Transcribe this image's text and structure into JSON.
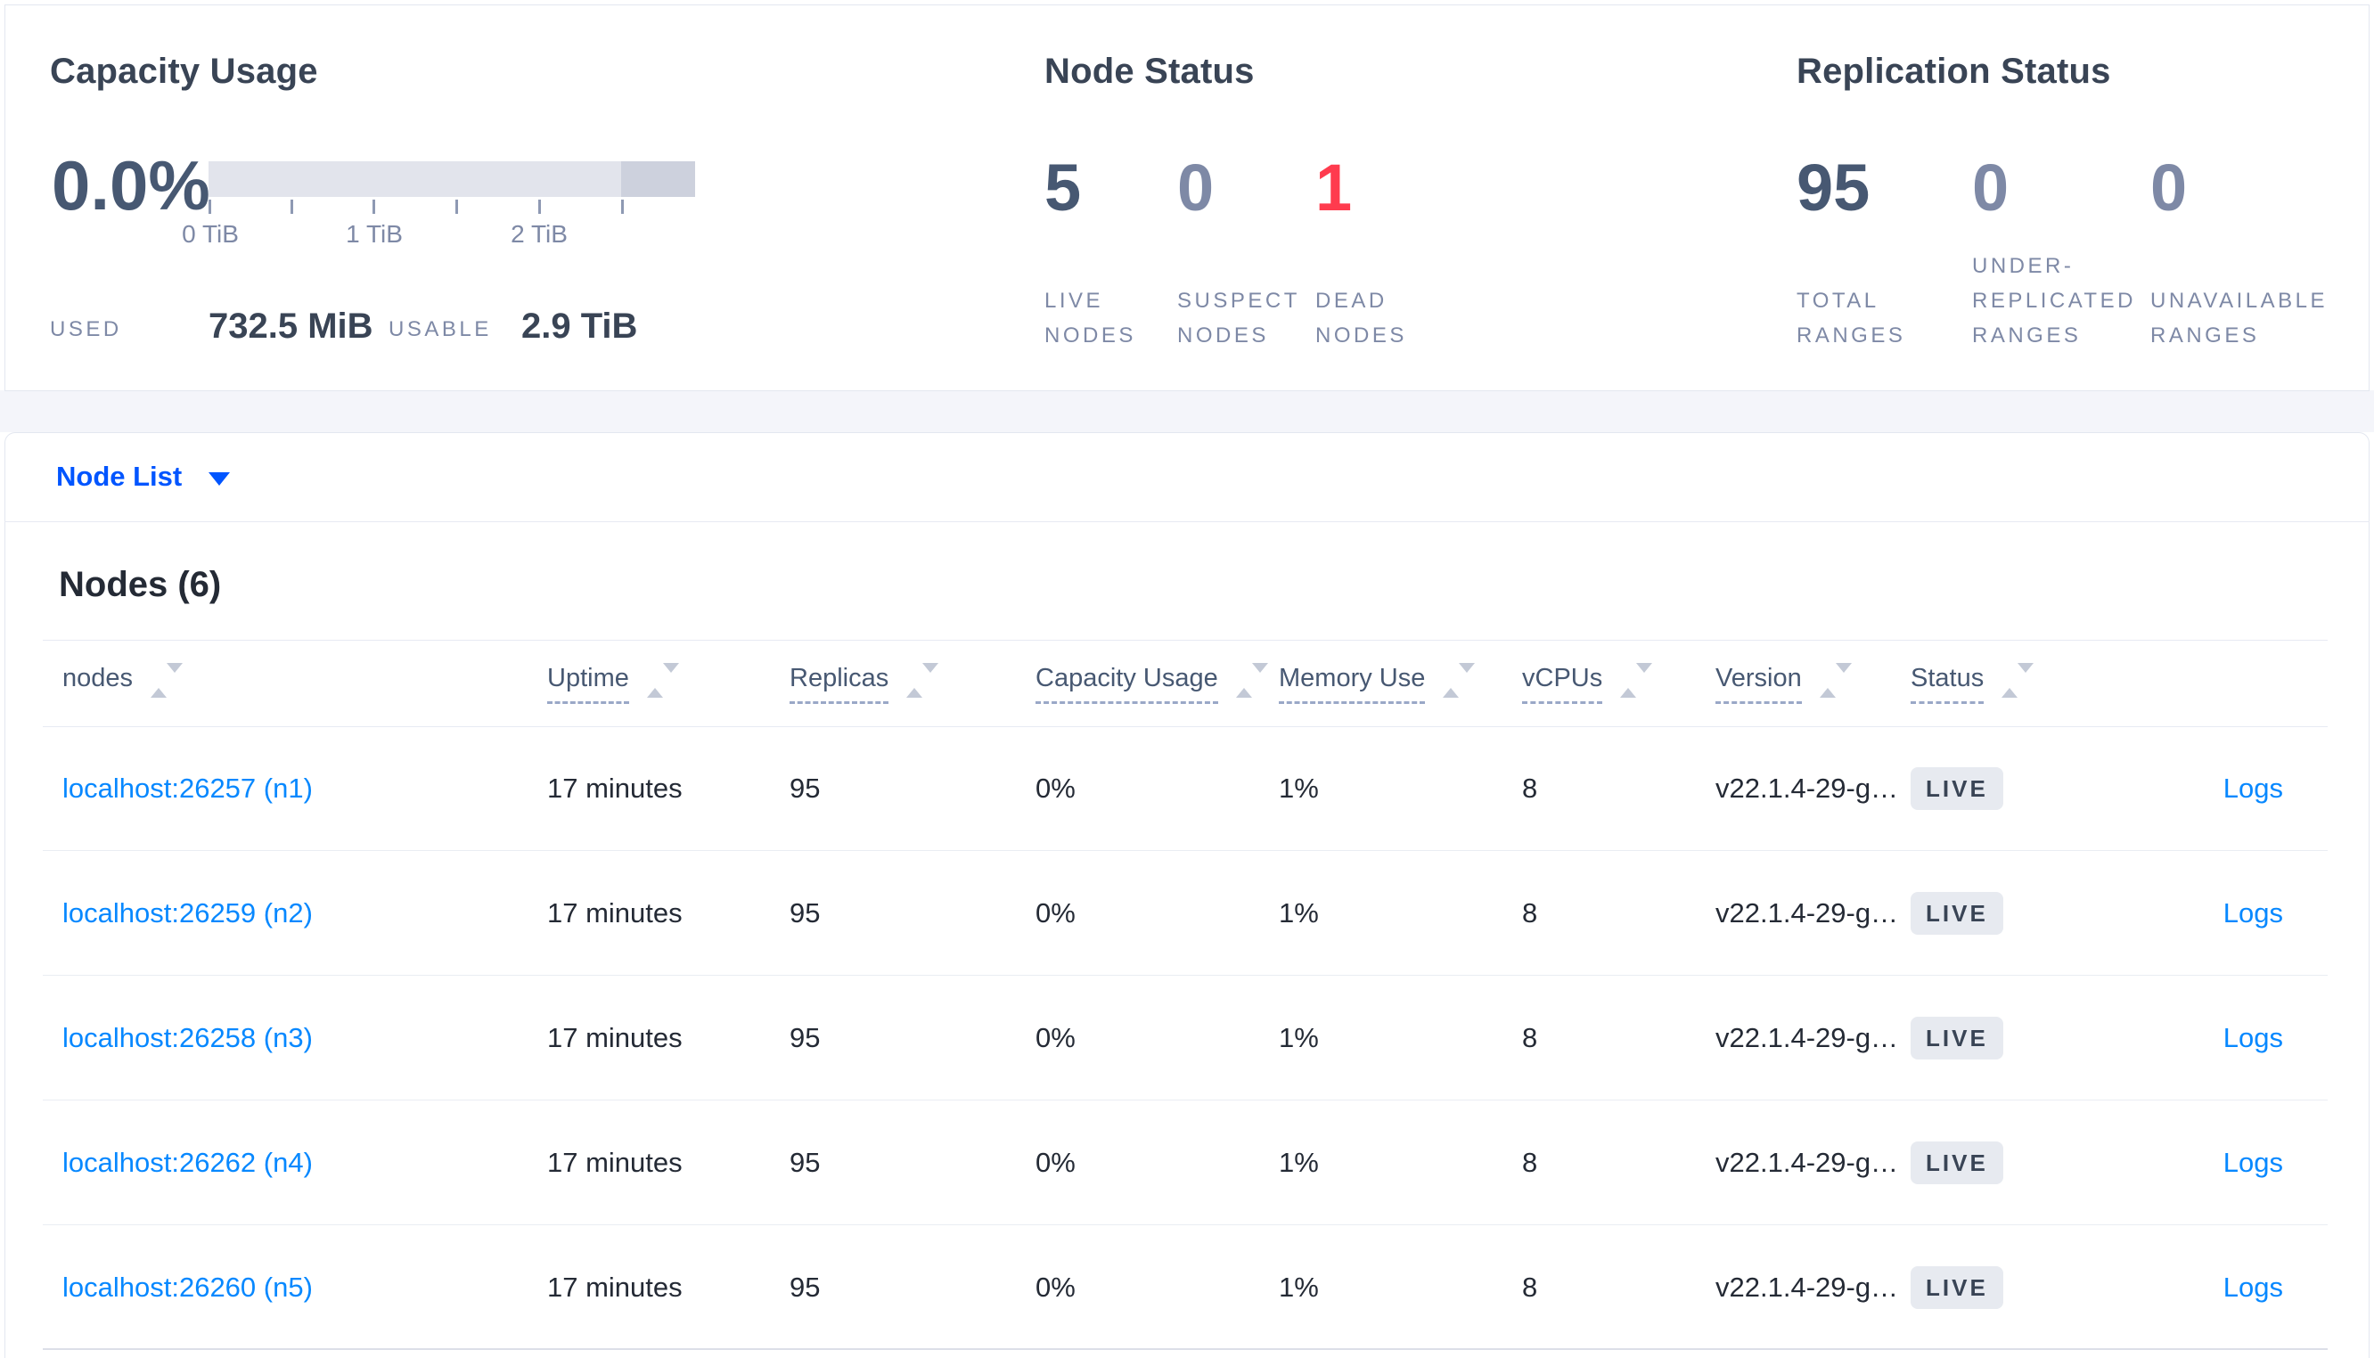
{
  "colors": {
    "link_blue": "#0788ff",
    "selector_blue": "#0055ff",
    "title_dark": "#394455",
    "stat_dark": "#475872",
    "stat_muted": "#7e89a6",
    "dead_red": "#ff3b4e",
    "badge_bg": "#e7eaf0",
    "page_band_bg": "#f4f5fa"
  },
  "summary": {
    "capacity": {
      "title": "Capacity Usage",
      "percent": "0.0%",
      "ticks": [
        "0 TiB",
        "1 TiB",
        "2 TiB"
      ],
      "used_label": "USED",
      "used_value": "732.5 MiB",
      "usable_label": "USABLE",
      "usable_value": "2.9 TiB"
    },
    "node_status": {
      "title": "Node Status",
      "stats": [
        {
          "value": "5",
          "label": "LIVE\nNODES",
          "color": "#475872"
        },
        {
          "value": "0",
          "label": "SUSPECT\nNODES",
          "color": "#7e89a6"
        },
        {
          "value": "1",
          "label": "DEAD\nNODES",
          "color": "#ff3b4e"
        }
      ]
    },
    "replication_status": {
      "title": "Replication Status",
      "stats": [
        {
          "value": "95",
          "label": "TOTAL\nRANGES",
          "color": "#475872"
        },
        {
          "value": "0",
          "label": "UNDER-\nREPLICATED\nRANGES",
          "color": "#7e89a6"
        },
        {
          "value": "0",
          "label": "UNAVAILABLE\nRANGES",
          "color": "#7e89a6"
        }
      ]
    }
  },
  "node_list": {
    "selector_label": "Node List"
  },
  "nodes_table": {
    "heading": "Nodes (6)",
    "columns": [
      {
        "label": "nodes"
      },
      {
        "label": "Uptime"
      },
      {
        "label": "Replicas"
      },
      {
        "label": "Capacity Usage"
      },
      {
        "label": "Memory Use"
      },
      {
        "label": "vCPUs"
      },
      {
        "label": "Version"
      },
      {
        "label": "Status"
      }
    ],
    "rows": [
      {
        "node": "localhost:26257 (n1)",
        "uptime": "17 minutes",
        "replicas": "95",
        "capacity_usage": "0%",
        "memory_use": "1%",
        "vcpus": "8",
        "version": "v22.1.4-29-g…",
        "status": "LIVE",
        "logs_label": "Logs"
      },
      {
        "node": "localhost:26259 (n2)",
        "uptime": "17 minutes",
        "replicas": "95",
        "capacity_usage": "0%",
        "memory_use": "1%",
        "vcpus": "8",
        "version": "v22.1.4-29-g…",
        "status": "LIVE",
        "logs_label": "Logs"
      },
      {
        "node": "localhost:26258 (n3)",
        "uptime": "17 minutes",
        "replicas": "95",
        "capacity_usage": "0%",
        "memory_use": "1%",
        "vcpus": "8",
        "version": "v22.1.4-29-g…",
        "status": "LIVE",
        "logs_label": "Logs"
      },
      {
        "node": "localhost:26262 (n4)",
        "uptime": "17 minutes",
        "replicas": "95",
        "capacity_usage": "0%",
        "memory_use": "1%",
        "vcpus": "8",
        "version": "v22.1.4-29-g…",
        "status": "LIVE",
        "logs_label": "Logs"
      },
      {
        "node": "localhost:26260 (n5)",
        "uptime": "17 minutes",
        "replicas": "95",
        "capacity_usage": "0%",
        "memory_use": "1%",
        "vcpus": "8",
        "version": "v22.1.4-29-g…",
        "status": "LIVE",
        "logs_label": "Logs"
      }
    ]
  }
}
